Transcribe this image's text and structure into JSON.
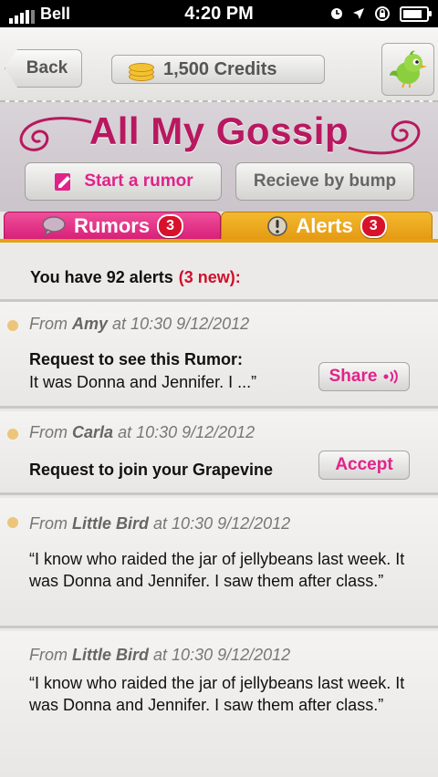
{
  "status_bar": {
    "carrier": "Bell",
    "time": "4:20 PM",
    "battery_level": 0.85
  },
  "nav": {
    "back_label": "Back",
    "credits_label": "1,500 Credits"
  },
  "header": {
    "title": "All My Gossip",
    "start_rumor_label": "Start a rumor",
    "receive_bump_label": "Recieve by bump"
  },
  "tabs": [
    {
      "label": "Rumors",
      "badge": "3",
      "icon": "speech-bubble-icon"
    },
    {
      "label": "Alerts",
      "badge": "3",
      "icon": "exclamation-icon"
    }
  ],
  "summary": {
    "text": "You have 92 alerts",
    "new": "(3 new):"
  },
  "alerts": [
    {
      "from_prefix": "From",
      "name": "Amy",
      "at": "at 10:30 9/12/2012",
      "title": "Request to see this Rumor:",
      "message": "It was Donna and Jennifer. I ...”",
      "button": "Share",
      "unread": true
    },
    {
      "from_prefix": "From",
      "name": "Carla",
      "at": "at 10:30 9/12/2012",
      "title": "Request to join your Grapevine",
      "button": "Accept",
      "unread": true
    },
    {
      "from_prefix": "From",
      "name": "Little Bird",
      "at": "at 10:30 9/12/2012",
      "message": "“I know who raided the jar of jellybeans last week.  It was Donna and Jennifer.  I saw them after class.”",
      "unread": true
    },
    {
      "from_prefix": "From",
      "name": "Little Bird",
      "at": "at 10:30 9/12/2012",
      "message": "“I know who raided the jar of jellybeans last week.  It was Donna and Jennifer.  I saw them after class.”",
      "unread": false
    }
  ],
  "colors": {
    "accent_pink": "#d81e79",
    "accent_orange": "#e49a12",
    "badge_red": "#d7122a",
    "unread_dot": "#ecc57a"
  }
}
